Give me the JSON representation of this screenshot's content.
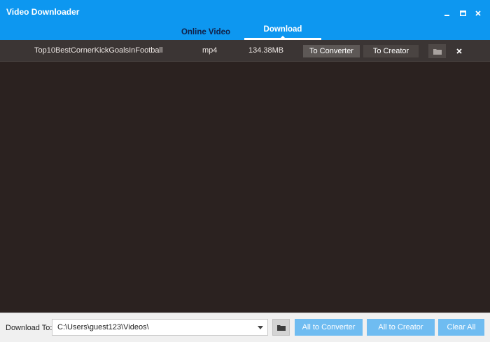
{
  "app": {
    "title": "Video Downloader"
  },
  "window_controls": {
    "minimize_icon": "minimize-icon",
    "maximize_icon": "maximize-icon",
    "close_icon": "close-icon"
  },
  "tabs": [
    {
      "label": "Online Video",
      "active": false
    },
    {
      "label": "Download",
      "active": true
    }
  ],
  "downloads": [
    {
      "name": "Top10BestCornerKickGoalsInFootball",
      "format": "mp4",
      "size": "134.38MB",
      "to_converter_label": "To Converter",
      "to_creator_label": "To Creator",
      "folder_icon": "folder-icon",
      "remove_icon": "close-icon"
    }
  ],
  "footer": {
    "download_to_label": "Download To:",
    "path": "C:\\Users\\guest123\\Videos\\",
    "all_to_converter_label": "All to Converter",
    "all_to_creator_label": "All to Creator",
    "clear_all_label": "Clear All"
  },
  "colors": {
    "titlebar": "#0d97f0",
    "list_bg": "#2b2220",
    "row_bg": "#3b3534",
    "accent_button": "#6fbcf1"
  }
}
